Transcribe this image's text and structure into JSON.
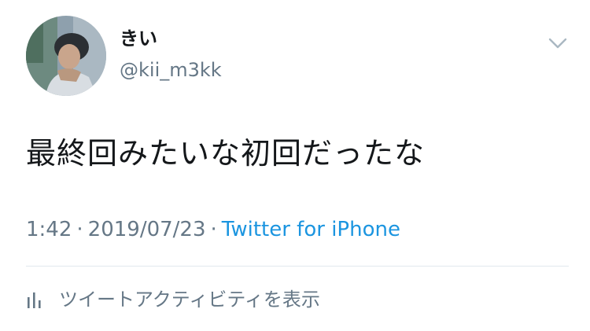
{
  "author": {
    "display_name": "きい",
    "handle": "@kii_m3kk"
  },
  "tweet": {
    "text": "最終回みたいな初回だったな",
    "time": "1:42",
    "date": "2019/07/23",
    "source": "Twitter for iPhone",
    "separator": "·"
  },
  "actions": {
    "activity_label": "ツイートアクティビティを表示"
  },
  "icons": {
    "caret": "chevron-down-icon",
    "activity": "bar-chart-icon"
  },
  "colors": {
    "text": "#14171a",
    "muted": "#657786",
    "link": "#1b95e0",
    "divider": "#e1e8ed"
  }
}
